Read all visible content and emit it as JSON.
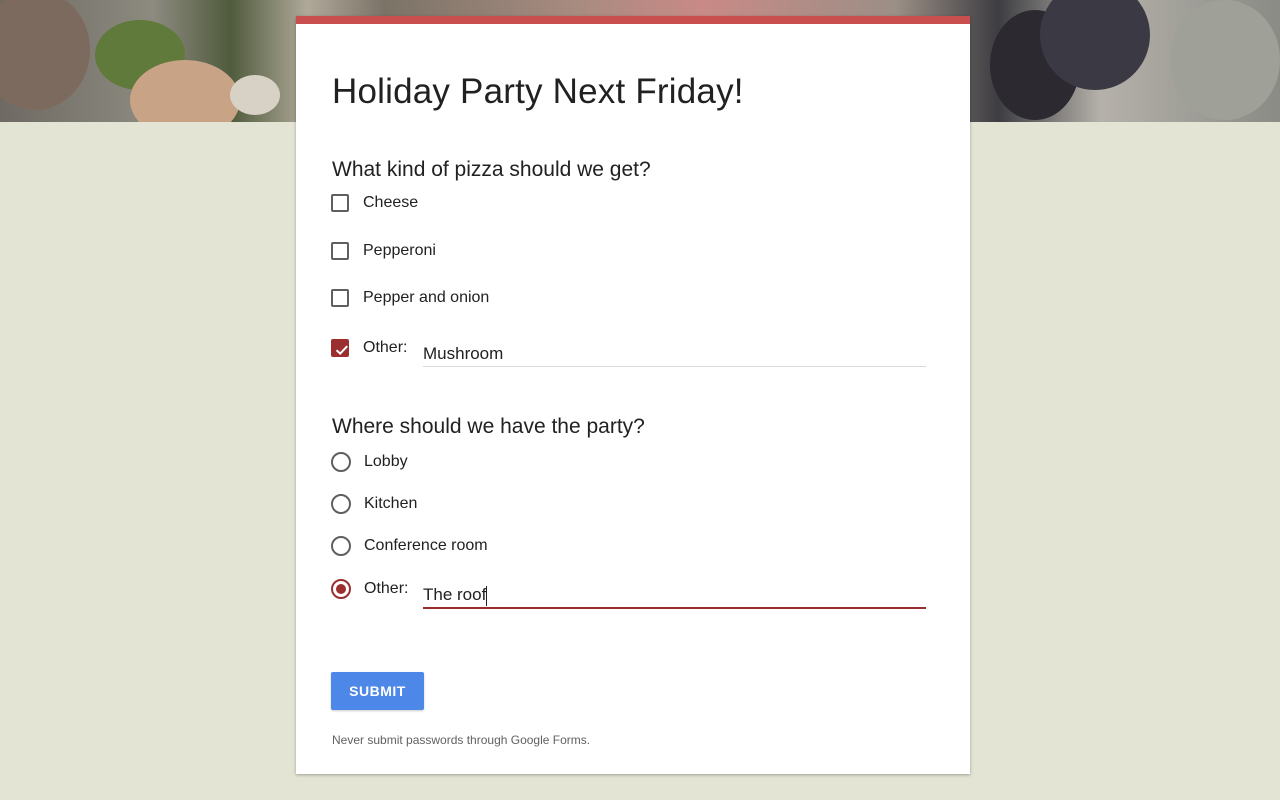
{
  "form": {
    "title": "Holiday Party Next Friday!",
    "accent_color": "#c94f4f",
    "selection_color": "#9b2f2f",
    "questions": [
      {
        "title": "What kind of pizza should we get?",
        "type": "checkbox",
        "options": [
          {
            "label": "Cheese",
            "checked": false
          },
          {
            "label": "Pepperoni",
            "checked": false
          },
          {
            "label": "Pepper and onion",
            "checked": false
          }
        ],
        "other": {
          "label": "Other:",
          "value": "Mushroom",
          "checked": true
        }
      },
      {
        "title": "Where should we have the party?",
        "type": "radio",
        "options": [
          {
            "label": "Lobby",
            "selected": false
          },
          {
            "label": "Kitchen",
            "selected": false
          },
          {
            "label": "Conference room",
            "selected": false
          }
        ],
        "other": {
          "label": "Other:",
          "value": "The roof",
          "selected": true
        }
      }
    ],
    "submit_label": "SUBMIT",
    "submit_color": "#4d87e8",
    "disclaimer": "Never submit passwords through Google Forms."
  },
  "page": {
    "background_color": "#e3e4d3"
  }
}
